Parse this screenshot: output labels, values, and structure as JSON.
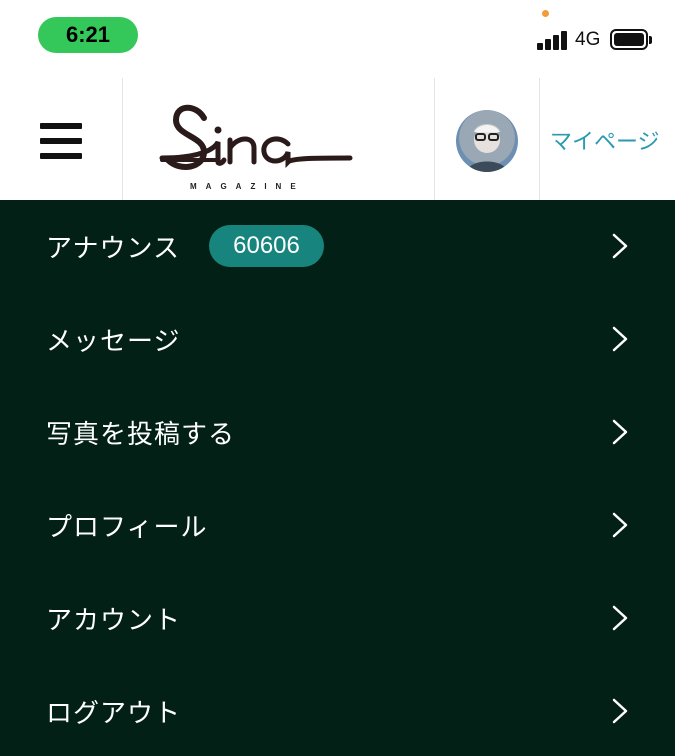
{
  "status_bar": {
    "time": "6:21",
    "network": "4G",
    "icons": [
      "signal-icon",
      "battery-icon"
    ]
  },
  "header": {
    "logo_text": "Sina",
    "logo_subtitle": "MAGAZINE",
    "mypage_label": "マイページ",
    "menu_icon": "hamburger-icon",
    "avatar": "user-avatar"
  },
  "menu": {
    "background": "#032016",
    "items": [
      {
        "label": "アナウンス",
        "badge": "60606"
      },
      {
        "label": "メッセージ"
      },
      {
        "label": "写真を投稿する"
      },
      {
        "label": "プロフィール"
      },
      {
        "label": "アカウント"
      },
      {
        "label": "ログアウト"
      }
    ]
  },
  "colors": {
    "time_pill": "#34c759",
    "badge": "#17857d",
    "link": "#2b9ab0"
  }
}
